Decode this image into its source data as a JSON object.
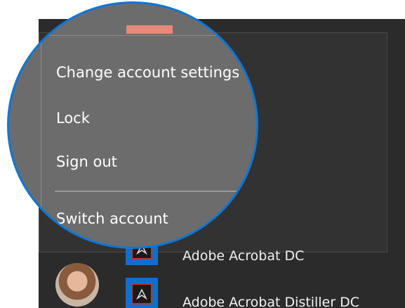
{
  "account_menu": {
    "items": [
      {
        "label": "Change account settings"
      },
      {
        "label": "Lock"
      },
      {
        "label": "Sign out"
      },
      {
        "label": "Switch account"
      }
    ]
  },
  "apps": [
    {
      "label": "Adobe Acrobat DC",
      "icon": "acrobat-icon"
    },
    {
      "label": "Adobe Acrobat Distiller DC",
      "icon": "acrobat-distiller-icon"
    }
  ],
  "colors": {
    "accent": "#e8897a",
    "highlight_ring": "#0d77d6",
    "tile": "#0f6fcf"
  }
}
